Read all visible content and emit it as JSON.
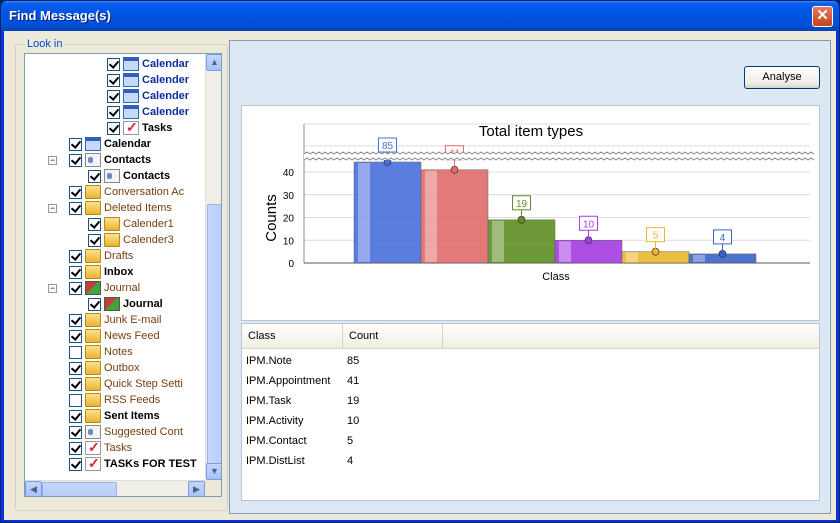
{
  "window": {
    "title": "Find Message(s)",
    "close_label": "✕"
  },
  "lookin": {
    "label": "Look in",
    "items": [
      {
        "label": "Calendar",
        "icon": "calendar",
        "checked": true,
        "bold": true,
        "color": "blue",
        "indent": 3,
        "expander": ""
      },
      {
        "label": "Calender",
        "icon": "calendar",
        "checked": true,
        "bold": true,
        "color": "blue",
        "indent": 3,
        "expander": ""
      },
      {
        "label": "Calender",
        "icon": "calendar",
        "checked": true,
        "bold": true,
        "color": "blue",
        "indent": 3,
        "expander": ""
      },
      {
        "label": "Calender",
        "icon": "calendar",
        "checked": true,
        "bold": true,
        "color": "blue",
        "indent": 3,
        "expander": ""
      },
      {
        "label": "Tasks",
        "icon": "tasks",
        "checked": true,
        "bold": true,
        "color": "",
        "indent": 3,
        "expander": ""
      },
      {
        "label": "Calendar",
        "icon": "calendar",
        "checked": true,
        "bold": true,
        "color": "",
        "indent": 1,
        "expander": ""
      },
      {
        "label": "Contacts",
        "icon": "contacts",
        "checked": true,
        "bold": true,
        "color": "",
        "indent": 1,
        "expander": "−"
      },
      {
        "label": "Contacts",
        "icon": "contacts",
        "checked": true,
        "bold": true,
        "color": "",
        "indent": 2,
        "expander": ""
      },
      {
        "label": "Conversation Ac",
        "icon": "folder",
        "checked": true,
        "bold": false,
        "color": "brown",
        "indent": 1,
        "expander": ""
      },
      {
        "label": "Deleted Items",
        "icon": "folder",
        "checked": true,
        "bold": false,
        "color": "brown",
        "indent": 1,
        "expander": "−"
      },
      {
        "label": "Calender1",
        "icon": "folder",
        "checked": true,
        "bold": false,
        "color": "brown",
        "indent": 2,
        "expander": ""
      },
      {
        "label": "Calender3",
        "icon": "folder",
        "checked": true,
        "bold": false,
        "color": "brown",
        "indent": 2,
        "expander": ""
      },
      {
        "label": "Drafts",
        "icon": "folder",
        "checked": true,
        "bold": false,
        "color": "brown",
        "indent": 1,
        "expander": ""
      },
      {
        "label": "Inbox",
        "icon": "folder",
        "checked": true,
        "bold": true,
        "color": "",
        "indent": 1,
        "expander": ""
      },
      {
        "label": "Journal",
        "icon": "journal",
        "checked": true,
        "bold": false,
        "color": "brown",
        "indent": 1,
        "expander": "−"
      },
      {
        "label": "Journal",
        "icon": "journal",
        "checked": true,
        "bold": true,
        "color": "",
        "indent": 2,
        "expander": ""
      },
      {
        "label": "Junk E-mail",
        "icon": "folder",
        "checked": true,
        "bold": false,
        "color": "brown",
        "indent": 1,
        "expander": ""
      },
      {
        "label": "News Feed",
        "icon": "folder",
        "checked": true,
        "bold": false,
        "color": "brown",
        "indent": 1,
        "expander": ""
      },
      {
        "label": "Notes",
        "icon": "folder",
        "checked": false,
        "bold": false,
        "color": "brown",
        "indent": 1,
        "expander": ""
      },
      {
        "label": "Outbox",
        "icon": "folder",
        "checked": true,
        "bold": false,
        "color": "brown",
        "indent": 1,
        "expander": ""
      },
      {
        "label": "Quick Step Setti",
        "icon": "folder",
        "checked": true,
        "bold": false,
        "color": "brown",
        "indent": 1,
        "expander": ""
      },
      {
        "label": "RSS Feeds",
        "icon": "folder",
        "checked": false,
        "bold": false,
        "color": "brown",
        "indent": 1,
        "expander": ""
      },
      {
        "label": "Sent Items",
        "icon": "folder",
        "checked": true,
        "bold": true,
        "color": "",
        "indent": 1,
        "expander": ""
      },
      {
        "label": "Suggested Cont",
        "icon": "contacts",
        "checked": true,
        "bold": false,
        "color": "brown",
        "indent": 1,
        "expander": ""
      },
      {
        "label": "Tasks",
        "icon": "tasks",
        "checked": true,
        "bold": false,
        "color": "brown",
        "indent": 1,
        "expander": ""
      },
      {
        "label": "TASKs FOR TEST",
        "icon": "tasks",
        "checked": true,
        "bold": true,
        "color": "",
        "indent": 1,
        "expander": ""
      }
    ]
  },
  "toolbar": {
    "analyse_label": "Analyse"
  },
  "chart_data": {
    "type": "bar",
    "title": "Total item types",
    "xlabel": "Class",
    "ylabel": "Counts",
    "categories": [
      "IPM.Note",
      "IPM.Appointment",
      "IPM.Task",
      "IPM.Activity",
      "IPM.Contact",
      "IPM.DistList"
    ],
    "values": [
      85,
      41,
      19,
      10,
      5,
      4
    ],
    "yticks": [
      "0",
      "10",
      "20",
      "30",
      "40"
    ],
    "ylim": [
      0,
      45
    ],
    "axis_break": true,
    "grid": true,
    "colors": [
      "#4a6fdc",
      "#e06c6c",
      "#5e8f23",
      "#a63de0",
      "#e9b62d",
      "#3b63c9"
    ]
  },
  "grid": {
    "columns": [
      "Class",
      "Count"
    ],
    "rows": [
      [
        "IPM.Note",
        "85"
      ],
      [
        "IPM.Appointment",
        "41"
      ],
      [
        "IPM.Task",
        "19"
      ],
      [
        "IPM.Activity",
        "10"
      ],
      [
        "IPM.Contact",
        "5"
      ],
      [
        "IPM.DistList",
        "4"
      ]
    ]
  }
}
